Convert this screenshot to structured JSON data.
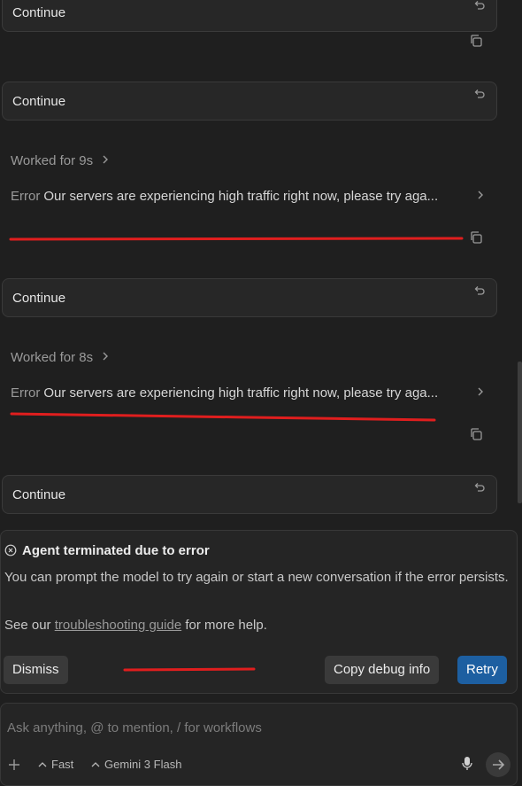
{
  "messages": [
    {
      "type": "continue",
      "label": "Continue"
    },
    {
      "type": "continue",
      "label": "Continue"
    },
    {
      "type": "worked",
      "label": "Worked for 9s"
    },
    {
      "type": "error",
      "label": "Error",
      "message": "Our servers are experiencing high traffic right now, please try aga..."
    },
    {
      "type": "continue",
      "label": "Continue"
    },
    {
      "type": "worked",
      "label": "Worked for 8s"
    },
    {
      "type": "error",
      "label": "Error",
      "message": "Our servers are experiencing high traffic right now, please try aga..."
    },
    {
      "type": "continue",
      "label": "Continue"
    }
  ],
  "banner": {
    "title": "Agent terminated due to error",
    "body": "You can prompt the model to try again or start a new conversation if the error persists.",
    "help_prefix": "See our ",
    "help_link": "troubleshooting guide",
    "help_suffix": " for more help.",
    "dismiss": "Dismiss",
    "copy_debug": "Copy debug info",
    "retry": "Retry"
  },
  "composer": {
    "placeholder": "Ask anything, @ to mention, / for workflows",
    "mode": "Fast",
    "model": "Gemini 3 Flash"
  },
  "colors": {
    "annotation_red": "#e01e1e",
    "accent_blue": "#1d5fa1"
  },
  "icons": [
    "undo-icon",
    "copy-icon",
    "chevron-right-icon",
    "error-circle-icon",
    "plus-icon",
    "chevron-up-icon",
    "mic-icon",
    "send-arrow-icon"
  ]
}
